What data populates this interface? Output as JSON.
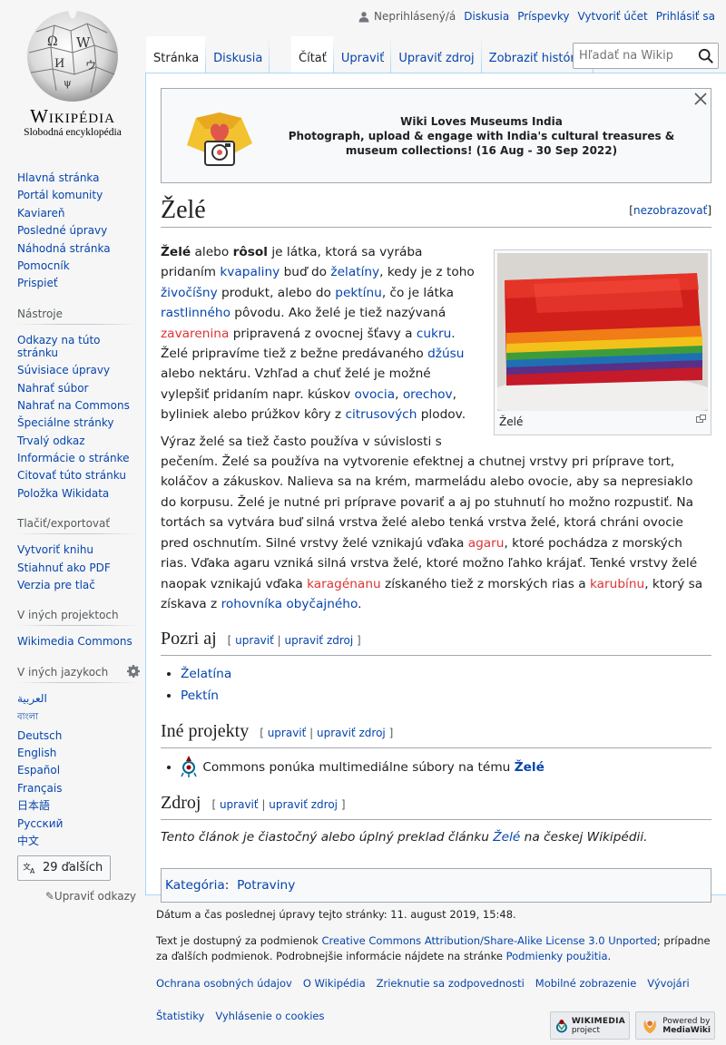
{
  "personal": {
    "anon": "Neprihlásený/á",
    "links": [
      "Diskusia",
      "Príspevky",
      "Vytvoriť účet",
      "Prihlásiť sa"
    ]
  },
  "logo": {
    "name": "Wikipédia",
    "tagline": "Slobodná encyklopédia"
  },
  "left_tabs": [
    "Stránka",
    "Diskusia"
  ],
  "right_tabs": [
    "Čítať",
    "Upraviť",
    "Upraviť zdroj",
    "Zobraziť históriu"
  ],
  "search": {
    "placeholder": "Hľadať na Wikipédii"
  },
  "sidebar": {
    "navigation": [
      "Hlavná stránka",
      "Portál komunity",
      "Kaviareň",
      "Posledné úpravy",
      "Náhodná stránka",
      "Pomocník",
      "Prispieť"
    ],
    "tools_title": "Nástroje",
    "tools": [
      "Odkazy na túto stránku",
      "Súvisiace úpravy",
      "Nahrať súbor",
      "Nahrať na Commons",
      "Špeciálne stránky",
      "Trvalý odkaz",
      "Informácie o stránke",
      "Citovať túto stránku",
      "Položka Wikidata"
    ],
    "print_title": "Tlačiť/exportovať",
    "print": [
      "Vytvoriť knihu",
      "Stiahnuť ako PDF",
      "Verzia pre tlač"
    ],
    "projects_title": "V iných projektoch",
    "projects": [
      "Wikimedia Commons"
    ],
    "langs_title": "V iných jazykoch",
    "langs": [
      "العربية",
      "বাংলা",
      "Deutsch",
      "English",
      "Español",
      "Français",
      "日本語",
      "Русский",
      "中文"
    ],
    "more_langs": "29 ďalších",
    "edit_links": "Upraviť odkazy"
  },
  "banner": {
    "line1": "Wiki Loves Museums India",
    "line2": "Photograph, upload & engage with India's cultural treasures & museum collections! (16 Aug - 30 Sep 2022)"
  },
  "title": "Želé",
  "hide_label": "nezobrazovať",
  "thumb_caption": "Želé",
  "para1": {
    "t1": "Želé",
    "t2": " alebo ",
    "t3": "rôsol",
    "t4": " je látka, ktorá sa vyrába pridaním ",
    "l1": "kvapaliny",
    "t5": " buď do ",
    "l2": "želatíny",
    "t6": ", kedy je z toho ",
    "l3": "živočíšny",
    "t7": " produkt, alebo do ",
    "l4": "pektínu",
    "t8": ", čo je látka ",
    "l5": "rastlinného",
    "t9": " pôvodu. Ako želé je tiež nazývaná ",
    "l6": "zavarenina",
    "t10": " pripravená z ovocnej šťavy a ",
    "l7": "cukru",
    "t11": ". Želé pripravíme tiež z bežne predávaného ",
    "l8": "džúsu",
    "t12": " alebo nektáru. Vzhľad a chuť želé je možné vylepšiť pridaním napr. kúskov ",
    "l9": "ovocia",
    "t13": ", ",
    "l10": "orechov",
    "t14": ", byliniek alebo prúžkov kôry z ",
    "l11": "citrusových",
    "t15": " plodov."
  },
  "para2": {
    "t1": "Výraz želé sa tiež často používa v súvislosti s pečením. Želé sa používa na vytvorenie efektnej a chutnej vrstvy pri príprave tort, koláčov a zákuskov. Nalieva sa na krém, marmeládu alebo ovocie, aby sa nepresiaklo do korpusu. Želé je nutné pri príprave povariť a aj po stuhnutí ho možno rozpustiť. Na tortách sa vytvára buď silná vrstva želé alebo tenká vrstva želé, ktorá chráni ovocie pred oschnutím. Silné vrstvy želé vznikajú vďaka ",
    "l1": "agaru",
    "t2": ", ktoré pochádza z morských rias. Vďaka agaru vzniká silná vrstva želé, ktoré možno ľahko krájať. Tenké vrstvy želé naopak vznikajú vďaka ",
    "l2": "karagénanu",
    "t3": " získaného tiež z morských rias a ",
    "l3": "karubínu",
    "t4": ", ktorý sa získava z ",
    "l4": "rohovníka obyčajného",
    "t5": "."
  },
  "sections": {
    "see_also": "Pozri aj",
    "other_projects": "Iné projekty",
    "source": "Zdroj",
    "edit": "upraviť",
    "edit_source": "upraviť zdroj"
  },
  "see_also_items": [
    "Želatína",
    "Pektín"
  ],
  "commons": {
    "t1": "Commons ponúka multimediálne súbory na tému ",
    "link": "Želé"
  },
  "source_text": {
    "t1": "Tento článok je čiastočný alebo úplný preklad článku ",
    "link": "Želé",
    "t2": " na českej Wikipédii."
  },
  "categories": {
    "label": "Kategória",
    "items": [
      "Potraviny"
    ]
  },
  "footer": {
    "lastmod": "Dátum a čas poslednej úpravy tejto stránky: 11. august 2019, 15:48.",
    "license_t1": "Text je dostupný za podmienok ",
    "license_link": "Creative Commons Attribution/Share-Alike License 3.0 Unported",
    "license_t2": "; prípadne za ďalších podmienok. Podrobnejšie informácie nájdete na stránke ",
    "terms_link": "Podmienky použitia",
    "license_t3": ".",
    "links1": [
      "Ochrana osobných údajov",
      "O Wikipédia",
      "Zrieknutie sa zodpovednosti",
      "Mobilné zobrazenie",
      "Vývojári"
    ],
    "links2": [
      "Štatistiky",
      "Vyhlásenie o cookies"
    ],
    "badge1": {
      "a": "WIKIMEDIA",
      "b": "project"
    },
    "badge2": {
      "a": "Powered by",
      "b": "MediaWiki"
    }
  },
  "colors": {
    "link": "#0645ad",
    "redlink": "#d33",
    "border": "#a7d7f9"
  }
}
